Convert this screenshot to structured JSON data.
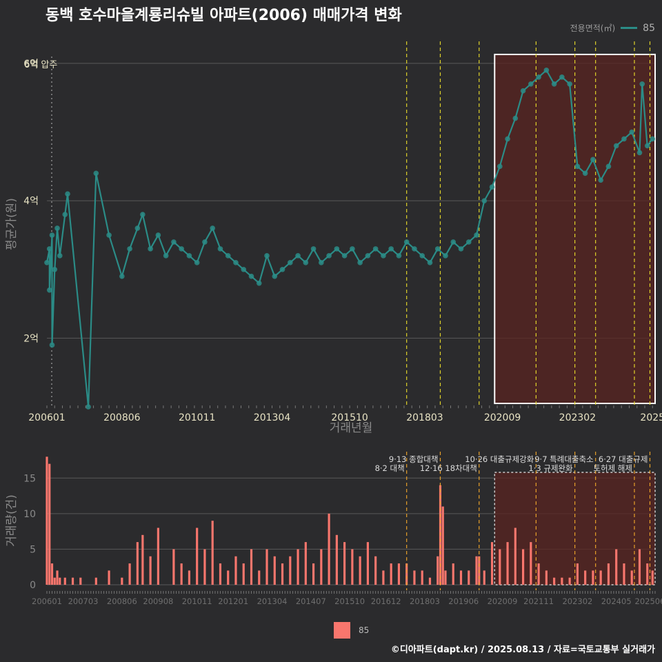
{
  "title": "동백 호수마을계룡리슈빌 아파트(2006) 매매가격 변화",
  "legend_top": {
    "label": "전용면적(㎡)",
    "series": "85",
    "color": "#2b8c87"
  },
  "legend_bottom": {
    "series": "85",
    "color": "#f8766d"
  },
  "caption": "©디아파트(dapt.kr) / 2025.08.13 / 자료=국토교통부 실거래가",
  "chart_data": [
    {
      "type": "line",
      "title": "동백 호수마을계룡리슈빌 아파트(2006) 매매가격 변화",
      "xlabel": "거래년월",
      "ylabel": "평균가(원)",
      "x_ticks": [
        "200601",
        "200806",
        "201011",
        "201304",
        "201510",
        "201803",
        "202009",
        "202302",
        "2025"
      ],
      "y_ticks": [
        "2억",
        "4억",
        "6억"
      ],
      "ylim": [
        1.0,
        6.3
      ],
      "annotation": "6억 압주",
      "highlight": {
        "from": "2020-06",
        "to": "2025-08"
      },
      "policy_lines": [
        "2017-08",
        "2018-09",
        "2019-12",
        "2021-10",
        "2023-01",
        "2023-09",
        "2024-12",
        "2025-06"
      ],
      "series": [
        {
          "name": "85",
          "points": [
            [
              "2006-01",
              3.1
            ],
            [
              "2006-02",
              3.3
            ],
            [
              "2006-03",
              3.5
            ],
            [
              "2006-04",
              3.0
            ],
            [
              "2006-05",
              3.6
            ],
            [
              "2006-06",
              3.2
            ],
            [
              "2006-08",
              3.8
            ],
            [
              "2006-09",
              4.1
            ],
            [
              "2007-05",
              1.0
            ],
            [
              "2007-08",
              4.4
            ],
            [
              "2006-03",
              1.9
            ],
            [
              "2006-02",
              2.7
            ],
            [
              "2008-01",
              3.5
            ],
            [
              "2008-06",
              2.9
            ],
            [
              "2008-09",
              3.3
            ],
            [
              "2008-12",
              3.6
            ],
            [
              "2009-02",
              3.8
            ],
            [
              "2009-05",
              3.3
            ],
            [
              "2009-08",
              3.5
            ],
            [
              "2009-11",
              3.2
            ],
            [
              "2010-02",
              3.4
            ],
            [
              "2010-05",
              3.3
            ],
            [
              "2010-08",
              3.2
            ],
            [
              "2010-11",
              3.1
            ],
            [
              "2011-02",
              3.4
            ],
            [
              "2011-05",
              3.6
            ],
            [
              "2011-08",
              3.3
            ],
            [
              "2011-11",
              3.2
            ],
            [
              "2012-02",
              3.1
            ],
            [
              "2012-05",
              3.0
            ],
            [
              "2012-08",
              2.9
            ],
            [
              "2012-11",
              2.8
            ],
            [
              "2013-02",
              3.2
            ],
            [
              "2013-05",
              2.9
            ],
            [
              "2013-08",
              3.0
            ],
            [
              "2013-11",
              3.1
            ],
            [
              "2014-02",
              3.2
            ],
            [
              "2014-05",
              3.1
            ],
            [
              "2014-08",
              3.3
            ],
            [
              "2014-11",
              3.1
            ],
            [
              "2015-02",
              3.2
            ],
            [
              "2015-05",
              3.3
            ],
            [
              "2015-08",
              3.2
            ],
            [
              "2015-11",
              3.3
            ],
            [
              "2016-02",
              3.1
            ],
            [
              "2016-05",
              3.2
            ],
            [
              "2016-08",
              3.3
            ],
            [
              "2016-11",
              3.2
            ],
            [
              "2017-02",
              3.3
            ],
            [
              "2017-05",
              3.2
            ],
            [
              "2017-08",
              3.4
            ],
            [
              "2017-11",
              3.3
            ],
            [
              "2018-02",
              3.2
            ],
            [
              "2018-05",
              3.1
            ],
            [
              "2018-08",
              3.3
            ],
            [
              "2018-11",
              3.2
            ],
            [
              "2019-02",
              3.4
            ],
            [
              "2019-05",
              3.3
            ],
            [
              "2019-08",
              3.4
            ],
            [
              "2019-11",
              3.5
            ],
            [
              "2020-02",
              4.0
            ],
            [
              "2020-05",
              4.2
            ],
            [
              "2020-08",
              4.5
            ],
            [
              "2020-11",
              4.9
            ],
            [
              "2021-02",
              5.2
            ],
            [
              "2021-05",
              5.6
            ],
            [
              "2021-08",
              5.7
            ],
            [
              "2021-11",
              5.8
            ],
            [
              "2022-02",
              5.9
            ],
            [
              "2022-05",
              5.7
            ],
            [
              "2022-08",
              5.8
            ],
            [
              "2022-11",
              5.7
            ],
            [
              "2023-02",
              4.5
            ],
            [
              "2023-05",
              4.4
            ],
            [
              "2023-08",
              4.6
            ],
            [
              "2023-11",
              4.3
            ],
            [
              "2024-02",
              4.5
            ],
            [
              "2024-05",
              4.8
            ],
            [
              "2024-08",
              4.9
            ],
            [
              "2024-11",
              5.0
            ],
            [
              "2025-02",
              4.7
            ],
            [
              "2025-05",
              4.8
            ],
            [
              "2025-07",
              4.9
            ],
            [
              "2025-03",
              5.7
            ]
          ]
        }
      ]
    },
    {
      "type": "bar",
      "ylabel": "거래량(건)",
      "ylim": [
        0,
        19
      ],
      "y_ticks": [
        "0",
        "5",
        "10",
        "15"
      ],
      "x_ticks": [
        "200601",
        "200703",
        "200806",
        "200908",
        "201011",
        "201201",
        "201304",
        "201407",
        "201510",
        "201612",
        "201803",
        "201906",
        "202009",
        "202111",
        "202302",
        "202405",
        "202506"
      ],
      "policy_labels": [
        {
          "date": "2017-08",
          "text": "8·2 대책"
        },
        {
          "date": "2018-09",
          "text": "9·13 종합대책"
        },
        {
          "date": "2019-12",
          "text": "12·16 18차대책"
        },
        {
          "date": "2021-10",
          "text": "10·26 대출규제강화"
        },
        {
          "date": "2023-01",
          "text": "1·3 규제완화"
        },
        {
          "date": "2023-09",
          "text": "9·7 특례대출축소"
        },
        {
          "date": "2024-12",
          "text": "토허제 해제"
        },
        {
          "date": "2025-06",
          "text": "6·27 대출규제"
        }
      ],
      "series": [
        {
          "name": "85",
          "values_by_month": {
            "2006-01": 18,
            "2006-02": 17,
            "2006-03": 3,
            "2006-04": 1,
            "2006-05": 2,
            "2006-06": 1,
            "2006-08": 1,
            "2006-11": 1,
            "2007-02": 1,
            "2007-08": 1,
            "2008-01": 2,
            "2008-06": 1,
            "2008-09": 3,
            "2008-12": 6,
            "2009-02": 7,
            "2009-05": 4,
            "2009-08": 8,
            "2010-02": 5,
            "2010-05": 3,
            "2010-08": 2,
            "2010-11": 8,
            "2011-02": 5,
            "2011-05": 9,
            "2011-08": 3,
            "2011-11": 2,
            "2012-02": 4,
            "2012-05": 3,
            "2012-08": 5,
            "2012-11": 2,
            "2013-02": 5,
            "2013-05": 4,
            "2013-08": 3,
            "2013-11": 4,
            "2014-02": 5,
            "2014-05": 6,
            "2014-08": 3,
            "2014-11": 5,
            "2015-02": 10,
            "2015-05": 7,
            "2015-08": 6,
            "2015-11": 5,
            "2016-02": 4,
            "2016-05": 6,
            "2016-08": 4,
            "2016-11": 2,
            "2017-02": 3,
            "2017-05": 3,
            "2017-08": 3,
            "2017-11": 2,
            "2018-02": 2,
            "2018-05": 1,
            "2018-08": 4,
            "2018-09": 14,
            "2018-10": 11,
            "2018-11": 2,
            "2019-02": 3,
            "2019-05": 2,
            "2019-08": 2,
            "2019-11": 4,
            "2019-12": 4,
            "2020-02": 2,
            "2020-05": 6,
            "2020-08": 5,
            "2020-11": 6,
            "2021-02": 8,
            "2021-05": 5,
            "2021-08": 6,
            "2021-11": 3,
            "2022-02": 2,
            "2022-05": 1,
            "2022-08": 1,
            "2022-11": 1,
            "2023-02": 3,
            "2023-05": 2,
            "2023-08": 2,
            "2023-11": 2,
            "2024-02": 3,
            "2024-05": 5,
            "2024-08": 3,
            "2024-11": 2,
            "2025-02": 5,
            "2025-05": 3,
            "2025-07": 2
          }
        }
      ]
    }
  ]
}
